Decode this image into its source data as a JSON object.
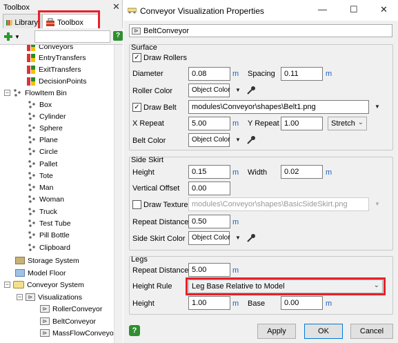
{
  "toolbox": {
    "title": "Toolbox",
    "close_glyph": "✕",
    "tabs": [
      {
        "label": "Library",
        "icon": "library-icon"
      },
      {
        "label": "Toolbox",
        "icon": "toolbox-icon"
      }
    ],
    "add_glyph": "+",
    "help_glyph": "?",
    "tree": [
      {
        "label": "Conveyors",
        "icon": "standard-tool-icon"
      },
      {
        "label": "EntryTransfers",
        "icon": "standard-tool-icon"
      },
      {
        "label": "ExitTransfers",
        "icon": "standard-tool-icon"
      },
      {
        "label": "DecisionPoints",
        "icon": "standard-tool-icon"
      },
      {
        "label": "FlowItem Bin",
        "icon": "flowitem-icon",
        "expander": "−"
      },
      {
        "label": "Box",
        "icon": "flowitem-icon"
      },
      {
        "label": "Cylinder",
        "icon": "flowitem-icon"
      },
      {
        "label": "Sphere",
        "icon": "flowitem-icon"
      },
      {
        "label": "Plane",
        "icon": "flowitem-icon"
      },
      {
        "label": "Circle",
        "icon": "flowitem-icon"
      },
      {
        "label": "Pallet",
        "icon": "flowitem-icon"
      },
      {
        "label": "Tote",
        "icon": "flowitem-icon"
      },
      {
        "label": "Man",
        "icon": "flowitem-icon"
      },
      {
        "label": "Woman",
        "icon": "flowitem-icon"
      },
      {
        "label": "Truck",
        "icon": "flowitem-icon"
      },
      {
        "label": "Test Tube",
        "icon": "flowitem-icon"
      },
      {
        "label": "Pill Bottle",
        "icon": "flowitem-icon"
      },
      {
        "label": "Clipboard",
        "icon": "flowitem-icon"
      },
      {
        "label": "Storage System",
        "icon": "storage-system-icon"
      },
      {
        "label": "Model Floor",
        "icon": "model-floor-icon"
      },
      {
        "label": "Conveyor System",
        "icon": "conveyor-system-icon",
        "expander": "−"
      },
      {
        "label": "Visualizations",
        "icon": "visualization-icon",
        "expander": "−"
      },
      {
        "label": "RollerConveyor",
        "icon": "visualization-icon"
      },
      {
        "label": "BeltConveyor",
        "icon": "visualization-icon"
      },
      {
        "label": "MassFlowConveyor",
        "icon": "visualization-icon"
      }
    ]
  },
  "dialog": {
    "title": "Conveyor Visualization Properties",
    "window_controls": {
      "minimize": "—",
      "maximize": "☐",
      "close": "✕"
    },
    "name": "BeltConveyor",
    "surface": {
      "title": "Surface",
      "draw_rollers_label": "Draw Rollers",
      "diameter_label": "Diameter",
      "diameter": "0.08",
      "diameter_unit": "m",
      "spacing_label": "Spacing",
      "spacing": "0.11",
      "spacing_unit": "m",
      "roller_color_label": "Roller Color",
      "roller_color": "Object Color",
      "draw_belt_label": "Draw Belt",
      "belt_path": "modules\\Conveyor\\shapes\\Belt1.png",
      "x_repeat_label": "X Repeat",
      "x_repeat": "5.00",
      "x_repeat_unit": "m",
      "y_repeat_label": "Y Repeat",
      "y_repeat": "1.00",
      "y_repeat_mode": "Stretch",
      "belt_color_label": "Belt Color",
      "belt_color": "Object Color"
    },
    "side_skirt": {
      "title": "Side Skirt",
      "height_label": "Height",
      "height": "0.15",
      "height_unit": "m",
      "width_label": "Width",
      "width": "0.02",
      "width_unit": "m",
      "vertical_offset_label": "Vertical Offset",
      "vertical_offset": "0.00",
      "draw_texture_label": "Draw Texture",
      "texture_path": "modules\\Conveyor\\shapes\\BasicSideSkirt.png",
      "repeat_distance_label": "Repeat Distance",
      "repeat_distance": "0.50",
      "repeat_distance_unit": "m",
      "side_skirt_color_label": "Side Skirt Color",
      "side_skirt_color": "Object Color"
    },
    "legs": {
      "title": "Legs",
      "repeat_distance_label": "Repeat Distance",
      "repeat_distance": "5.00",
      "repeat_distance_unit": "m",
      "height_rule_label": "Height Rule",
      "height_rule": "Leg Base Relative to Model",
      "height_label": "Height",
      "height": "1.00",
      "height_unit": "m",
      "base_label": "Base",
      "base": "0.00",
      "base_unit": "m"
    },
    "buttons": {
      "apply": "Apply",
      "ok": "OK",
      "cancel": "Cancel",
      "help": "?"
    }
  },
  "colors": {
    "highlight": "#e8202a",
    "unit": "#1b5fc1",
    "selection": "#cfe3f5"
  }
}
